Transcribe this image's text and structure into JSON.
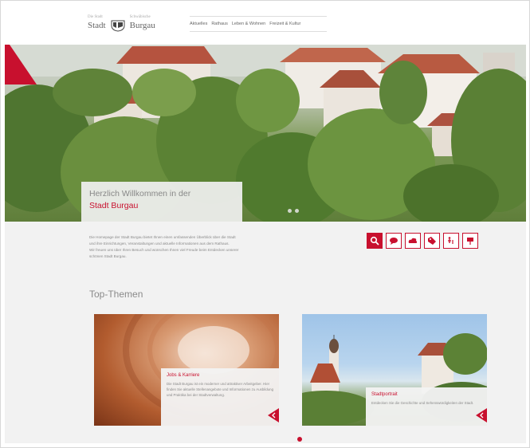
{
  "header": {
    "logo": {
      "left_small": "Die Stadt",
      "left_word": "Stadt",
      "right_small": "Schwäbische",
      "right_word": "Burgau",
      "crest_icon": "crest-icon"
    },
    "nav": [
      "Aktuelles",
      "Rathaus",
      "Leben & Wohnen",
      "Freizeit & Kultur"
    ]
  },
  "hero": {
    "line1": "Herzlich Willkommen in der",
    "line2": "Stadt Burgau",
    "slides": 2,
    "active_slide": 1
  },
  "intro": {
    "lines": [
      "Die Homepage der Stadt Burgau bietet Ihnen einen umfassenden Überblick über die Stadt",
      "und ihre Einrichtungen, Veranstaltungen und aktuelle Informationen aus dem Rathaus.",
      "Wir freuen uns über Ihren Besuch und wünschen Ihnen viel Freude beim Entdecken unserer",
      "schönen Stadt Burgau."
    ]
  },
  "quick_icons": [
    {
      "name": "search-icon",
      "active": true
    },
    {
      "name": "chat-icon",
      "active": false
    },
    {
      "name": "cloud-icon",
      "active": false
    },
    {
      "name": "tags-icon",
      "active": false
    },
    {
      "name": "accessibility-icon",
      "active": false
    },
    {
      "name": "flag-icon",
      "active": false
    }
  ],
  "top_themes": {
    "title": "Top-Themen",
    "cards": [
      {
        "title": "Jobs & Karriere",
        "description": "Die Stadt Burgau ist ein moderner und attraktiver Arbeitgeber. Hier finden Sie aktuelle Stellenangebote und Informationen zu Ausbildung und Praktika bei der Stadtverwaltung."
      },
      {
        "title": "Stadtportrait",
        "description": "Entdecken Sie die Geschichte und Sehenswürdigkeiten der Stadt."
      }
    ]
  },
  "pager": {
    "count": 1,
    "active": 0
  },
  "colors": {
    "accent": "#c8102e",
    "background": "#f2f2f2"
  }
}
